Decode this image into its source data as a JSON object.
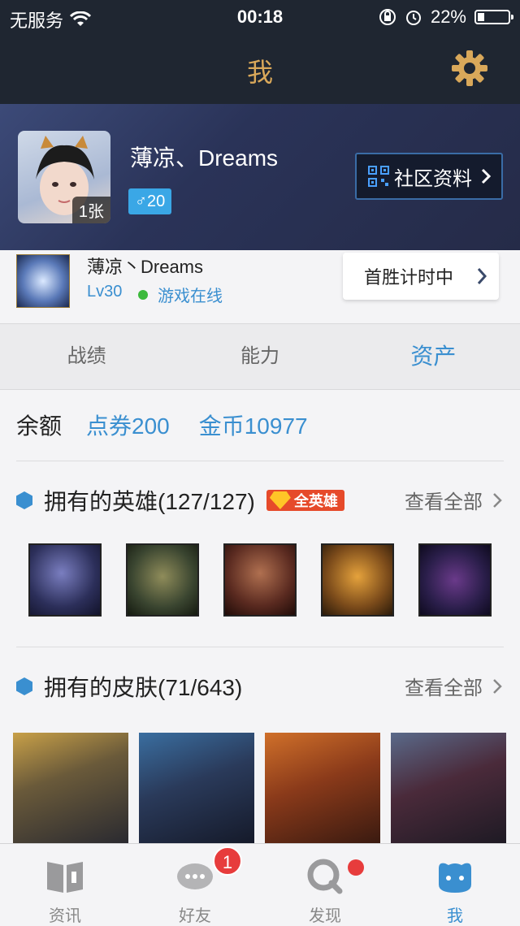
{
  "status_bar": {
    "carrier": "无服务",
    "time": "00:18",
    "battery_percent": "22%",
    "battery_level": 0.22
  },
  "nav": {
    "title": "我"
  },
  "profile": {
    "name": "薄凉、Dreams",
    "photo_count": "1张",
    "gender_age": "♂20",
    "community_label": "社区资料"
  },
  "game": {
    "name": "薄凉丶Dreams",
    "level": "Lv30",
    "status": "游戏在线",
    "first_win": "首胜计时中"
  },
  "tabs": [
    {
      "label": "战绩",
      "active": false
    },
    {
      "label": "能力",
      "active": false
    },
    {
      "label": "资产",
      "active": true
    }
  ],
  "balance": {
    "label": "余额",
    "coupons": "点券200",
    "gold": "金币10977"
  },
  "heroes_section": {
    "title": "拥有的英雄(127/127)",
    "badge": "全英雄",
    "view_all": "查看全部"
  },
  "skins_section": {
    "title": "拥有的皮肤(71/643)",
    "view_all": "查看全部"
  },
  "bottom_tabs": [
    {
      "label": "资讯",
      "icon": "book-icon"
    },
    {
      "label": "好友",
      "icon": "chat-icon",
      "badge": "1"
    },
    {
      "label": "发现",
      "icon": "search-icon"
    },
    {
      "label": "我",
      "icon": "me-icon",
      "active": true
    }
  ],
  "colors": {
    "accent": "#3a8fd0",
    "nav_bg": "#1f2631",
    "title_gold": "#d9a85a",
    "badge_red": "#e73c3c"
  }
}
